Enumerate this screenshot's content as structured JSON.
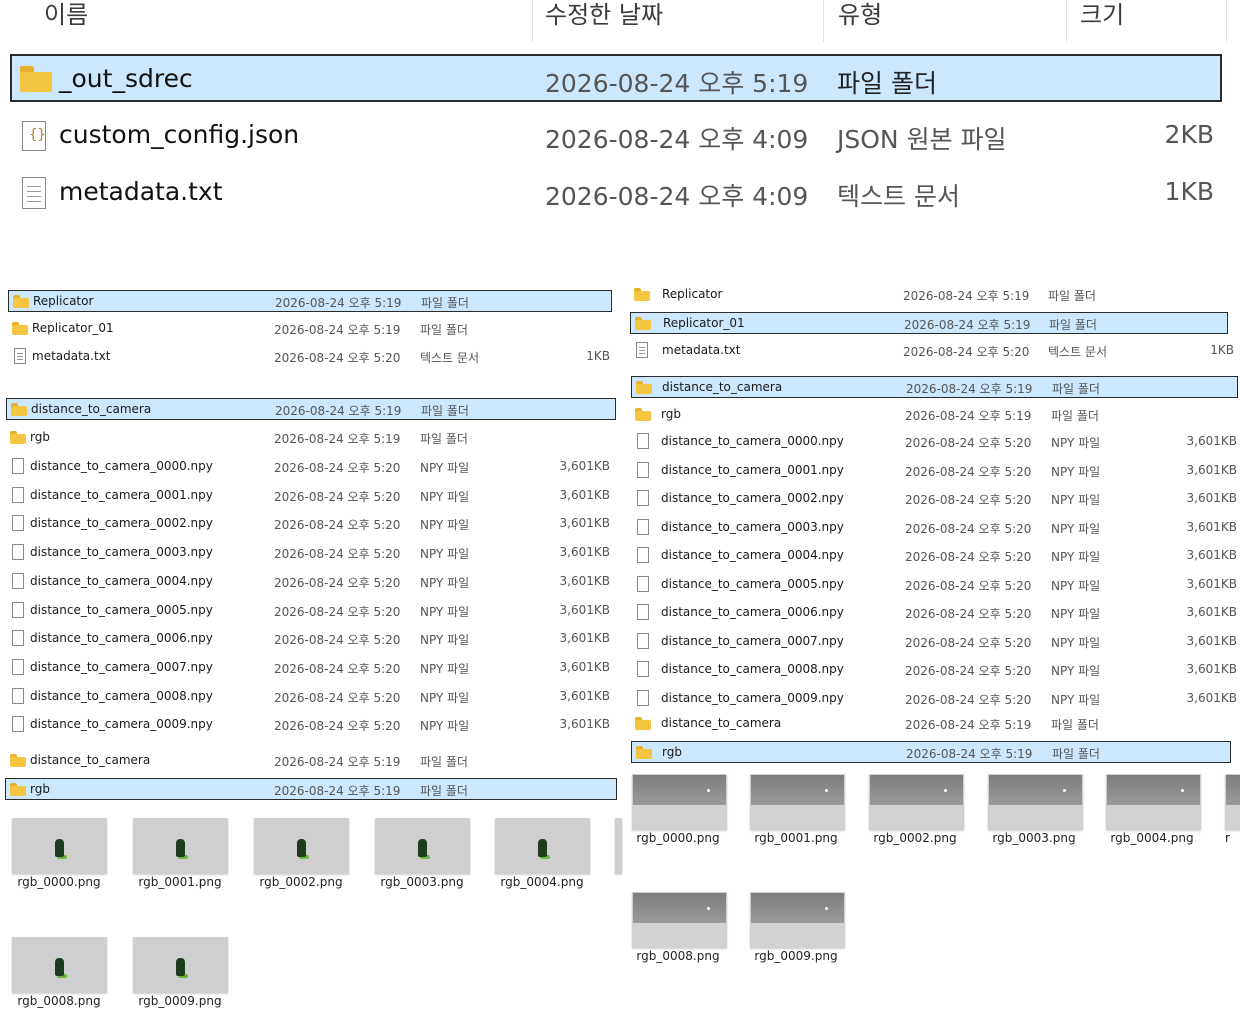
{
  "header": {
    "name": "이름",
    "date": "수정한 날짜",
    "type": "유형",
    "size": "크기"
  },
  "top_rows": [
    {
      "name": "_out_sdrec",
      "date": "2026-08-24 오후 5:19",
      "type": "파일 폴더",
      "size": "",
      "icon": "folder-icon"
    },
    {
      "name": "custom_config.json",
      "date": "2026-08-24 오후 4:09",
      "type": "JSON 원본 파일",
      "size": "2KB",
      "icon": "json-file-icon"
    },
    {
      "name": "metadata.txt",
      "date": "2026-08-24 오후 4:09",
      "type": "텍스트 문서",
      "size": "1KB",
      "icon": "text-file-icon"
    }
  ],
  "left_panel": {
    "group1": [
      {
        "name": "Replicator",
        "date": "2026-08-24 오후 5:19",
        "type": "파일 폴더",
        "size": ""
      },
      {
        "name": "Replicator_01",
        "date": "2026-08-24 오후 5:19",
        "type": "파일 폴더",
        "size": ""
      },
      {
        "name": "metadata.txt",
        "date": "2026-08-24 오후 5:20",
        "type": "텍스트 문서",
        "size": "1KB"
      }
    ],
    "group2": [
      {
        "name": "distance_to_camera",
        "date": "2026-08-24 오후 5:19",
        "type": "파일 폴더",
        "size": ""
      },
      {
        "name": "rgb",
        "date": "2026-08-24 오후 5:19",
        "type": "파일 폴더",
        "size": ""
      },
      {
        "name": "distance_to_camera_0000.npy",
        "date": "2026-08-24 오후 5:20",
        "type": "NPY 파일",
        "size": "3,601KB"
      },
      {
        "name": "distance_to_camera_0001.npy",
        "date": "2026-08-24 오후 5:20",
        "type": "NPY 파일",
        "size": "3,601KB"
      },
      {
        "name": "distance_to_camera_0002.npy",
        "date": "2026-08-24 오후 5:20",
        "type": "NPY 파일",
        "size": "3,601KB"
      },
      {
        "name": "distance_to_camera_0003.npy",
        "date": "2026-08-24 오후 5:20",
        "type": "NPY 파일",
        "size": "3,601KB"
      },
      {
        "name": "distance_to_camera_0004.npy",
        "date": "2026-08-24 오후 5:20",
        "type": "NPY 파일",
        "size": "3,601KB"
      },
      {
        "name": "distance_to_camera_0005.npy",
        "date": "2026-08-24 오후 5:20",
        "type": "NPY 파일",
        "size": "3,601KB"
      },
      {
        "name": "distance_to_camera_0006.npy",
        "date": "2026-08-24 오후 5:20",
        "type": "NPY 파일",
        "size": "3,601KB"
      },
      {
        "name": "distance_to_camera_0007.npy",
        "date": "2026-08-24 오후 5:20",
        "type": "NPY 파일",
        "size": "3,601KB"
      },
      {
        "name": "distance_to_camera_0008.npy",
        "date": "2026-08-24 오후 5:20",
        "type": "NPY 파일",
        "size": "3,601KB"
      },
      {
        "name": "distance_to_camera_0009.npy",
        "date": "2026-08-24 오후 5:20",
        "type": "NPY 파일",
        "size": "3,601KB"
      }
    ],
    "group3": [
      {
        "name": "distance_to_camera",
        "date": "2026-08-24 오후 5:19",
        "type": "파일 폴더",
        "size": ""
      },
      {
        "name": "rgb",
        "date": "2026-08-24 오후 5:19",
        "type": "파일 폴더",
        "size": ""
      }
    ],
    "thumbs": [
      "rgb_0000.png",
      "rgb_0001.png",
      "rgb_0002.png",
      "rgb_0003.png",
      "rgb_0004.png",
      "rgb_0008.png",
      "rgb_0009.png"
    ]
  },
  "right_panel": {
    "group1": [
      {
        "name": "Replicator",
        "date": "2026-08-24 오후 5:19",
        "type": "파일 폴더",
        "size": ""
      },
      {
        "name": "Replicator_01",
        "date": "2026-08-24 오후 5:19",
        "type": "파일 폴더",
        "size": ""
      },
      {
        "name": "metadata.txt",
        "date": "2026-08-24 오후 5:20",
        "type": "텍스트 문서",
        "size": "1KB"
      }
    ],
    "group2": [
      {
        "name": "distance_to_camera",
        "date": "2026-08-24 오후 5:19",
        "type": "파일 폴더",
        "size": ""
      },
      {
        "name": "rgb",
        "date": "2026-08-24 오후 5:19",
        "type": "파일 폴더",
        "size": ""
      },
      {
        "name": "distance_to_camera_0000.npy",
        "date": "2026-08-24 오후 5:20",
        "type": "NPY 파일",
        "size": "3,601KB"
      },
      {
        "name": "distance_to_camera_0001.npy",
        "date": "2026-08-24 오후 5:20",
        "type": "NPY 파일",
        "size": "3,601KB"
      },
      {
        "name": "distance_to_camera_0002.npy",
        "date": "2026-08-24 오후 5:20",
        "type": "NPY 파일",
        "size": "3,601KB"
      },
      {
        "name": "distance_to_camera_0003.npy",
        "date": "2026-08-24 오후 5:20",
        "type": "NPY 파일",
        "size": "3,601KB"
      },
      {
        "name": "distance_to_camera_0004.npy",
        "date": "2026-08-24 오후 5:20",
        "type": "NPY 파일",
        "size": "3,601KB"
      },
      {
        "name": "distance_to_camera_0005.npy",
        "date": "2026-08-24 오후 5:20",
        "type": "NPY 파일",
        "size": "3,601KB"
      },
      {
        "name": "distance_to_camera_0006.npy",
        "date": "2026-08-24 오후 5:20",
        "type": "NPY 파일",
        "size": "3,601KB"
      },
      {
        "name": "distance_to_camera_0007.npy",
        "date": "2026-08-24 오후 5:20",
        "type": "NPY 파일",
        "size": "3,601KB"
      },
      {
        "name": "distance_to_camera_0008.npy",
        "date": "2026-08-24 오후 5:20",
        "type": "NPY 파일",
        "size": "3,601KB"
      },
      {
        "name": "distance_to_camera_0009.npy",
        "date": "2026-08-24 오후 5:20",
        "type": "NPY 파일",
        "size": "3,601KB"
      }
    ],
    "group3": [
      {
        "name": "distance_to_camera",
        "date": "2026-08-24 오후 5:19",
        "type": "파일 폴더",
        "size": ""
      },
      {
        "name": "rgb",
        "date": "2026-08-24 오후 5:19",
        "type": "파일 폴더",
        "size": ""
      }
    ],
    "thumbs": [
      "rgb_0000.png",
      "rgb_0001.png",
      "rgb_0002.png",
      "rgb_0003.png",
      "rgb_0004.png",
      "r",
      "rgb_0008.png",
      "rgb_0009.png"
    ]
  },
  "colors": {
    "selection": "#cce8ff",
    "folder": "#f5c542"
  }
}
